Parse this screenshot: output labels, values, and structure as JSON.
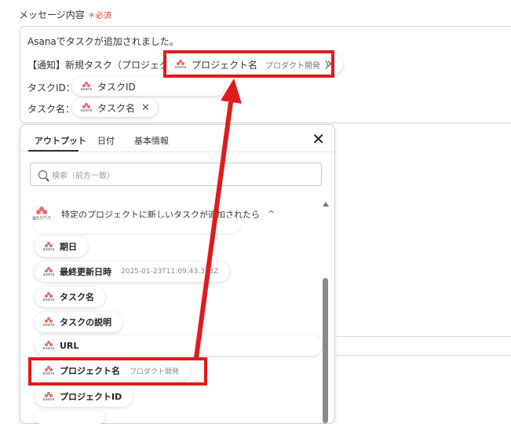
{
  "field": {
    "label": "メッセージ内容",
    "required_mark": "＊",
    "required_text": "必須"
  },
  "editor": {
    "line1": "Asanaでタスクが追加されました。",
    "line2_prefix": "【通知】新規タスク（プロジェクト：",
    "line2_suffix": "）",
    "line3_prefix": "タスクID：",
    "line4_prefix": "タスク名：",
    "chip_project": {
      "label": "プロジェクト名",
      "sub": "プロダクト開発",
      "icon": "asana-logo",
      "remove_icon": "close-icon"
    },
    "chip_taskid": {
      "label": "タスクID",
      "icon": "asana-logo"
    },
    "chip_taskname": {
      "label": "タスク名",
      "icon": "asana-logo",
      "remove_icon": "close-icon"
    }
  },
  "logo_text": "asana",
  "panel": {
    "tabs": [
      {
        "label": "アウトプット",
        "active": true
      },
      {
        "label": "日付",
        "active": false
      },
      {
        "label": "基本情報",
        "active": false
      }
    ],
    "close_icon": "close-icon",
    "search_placeholder": "検索（前方一致）",
    "section_title": "特定のプロジェクトに新しいタスクが追加されたら",
    "section_chevron": "^",
    "items": [
      {
        "label": "期日",
        "sub": ""
      },
      {
        "label": "最終更新日時",
        "sub": "2025-01-23T11:09:43.373Z"
      },
      {
        "label": "タスク名",
        "sub": ""
      },
      {
        "label": "タスクの説明",
        "sub": ""
      },
      {
        "label": "URL",
        "sub": ""
      },
      {
        "label": "プロジェクト名",
        "sub": "プロダクト開発"
      },
      {
        "label": "プロジェクトID",
        "sub": ""
      }
    ]
  },
  "highlight_color": "#e01b1b"
}
